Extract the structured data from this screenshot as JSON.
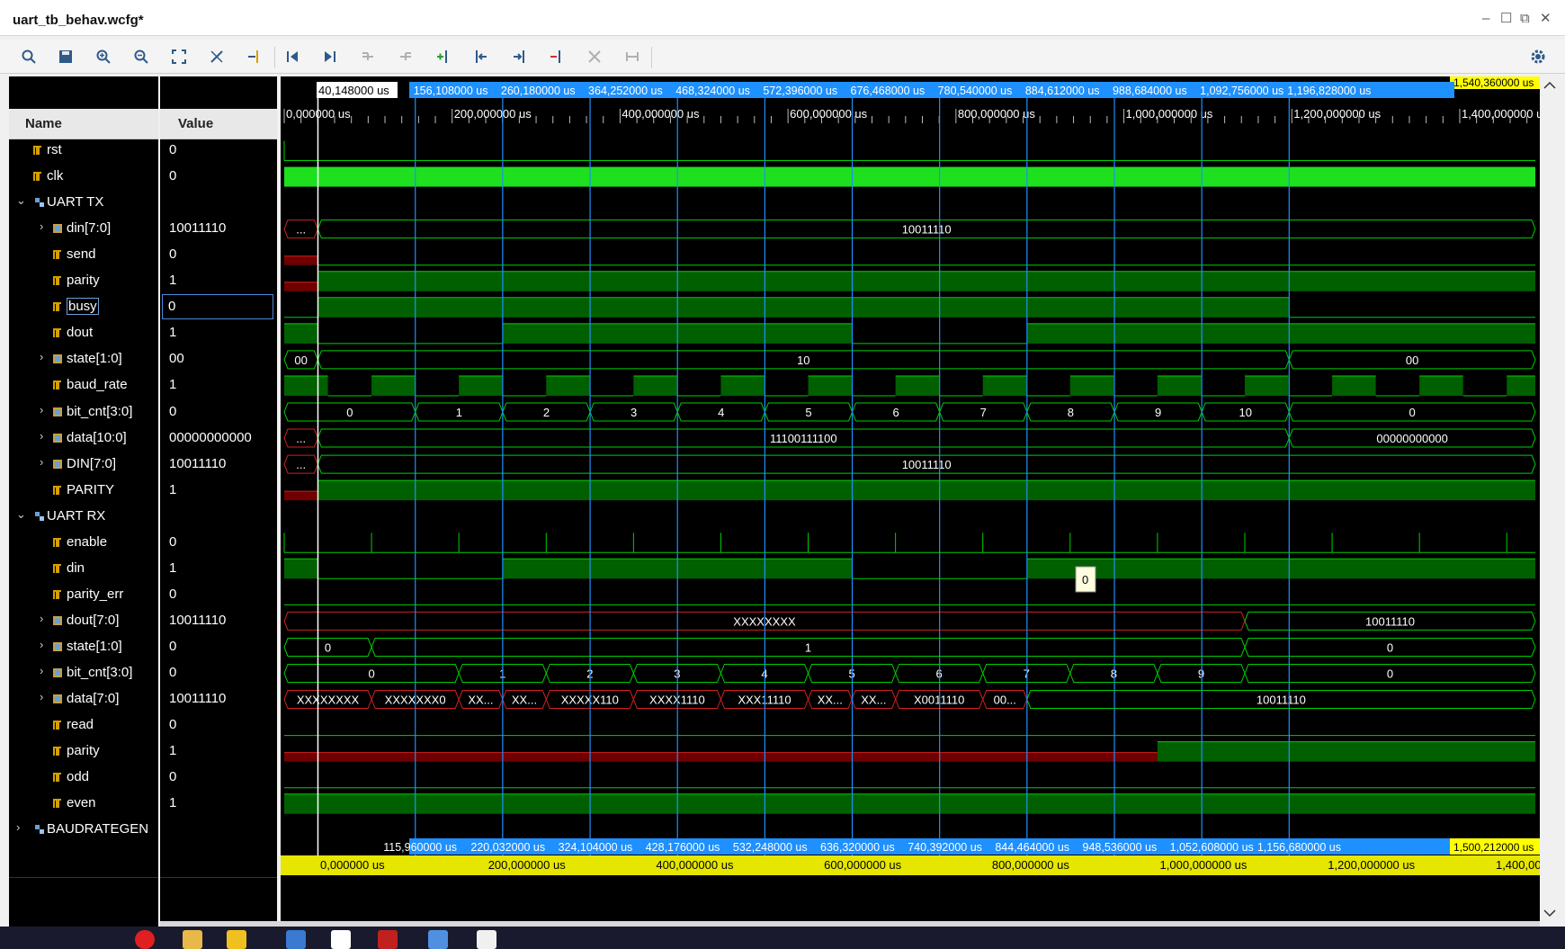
{
  "window": {
    "title": "uart_tb_behav.wcfg*",
    "controls": [
      "–",
      "☐",
      "⧉",
      "✕"
    ]
  },
  "toolbar": {
    "buttons": [
      "search",
      "save",
      "zoom-in",
      "zoom-out",
      "zoom-fit",
      "swap-cursors",
      "go-to-cursor",
      "go-to-time-0",
      "go-to-last-time",
      "previous-transition",
      "next-transition",
      "add-marker",
      "previous-marker",
      "next-marker",
      "remove-marker",
      "delete-all-markers",
      "snap-to-transition",
      "settings"
    ]
  },
  "panels": {
    "name_header": "Name",
    "value_header": "Value"
  },
  "signals": [
    {
      "name": "rst",
      "value": "0",
      "indent": 1,
      "kind": "bit",
      "expand": false
    },
    {
      "name": "clk",
      "value": "0",
      "indent": 1,
      "kind": "bit",
      "expand": false
    },
    {
      "name": "UART TX",
      "value": "",
      "indent": 0,
      "kind": "group",
      "expand": true
    },
    {
      "name": "din[7:0]",
      "value": "10011110",
      "indent": 2,
      "kind": "bus",
      "expand": true
    },
    {
      "name": "send",
      "value": "0",
      "indent": 2,
      "kind": "bit",
      "expand": false
    },
    {
      "name": "parity",
      "value": "1",
      "indent": 2,
      "kind": "bit",
      "expand": false
    },
    {
      "name": "busy",
      "value": "0",
      "indent": 2,
      "kind": "bit",
      "expand": false,
      "selected": true
    },
    {
      "name": "dout",
      "value": "1",
      "indent": 2,
      "kind": "bit",
      "expand": false
    },
    {
      "name": "state[1:0]",
      "value": "00",
      "indent": 2,
      "kind": "bus",
      "expand": true
    },
    {
      "name": "baud_rate",
      "value": "1",
      "indent": 2,
      "kind": "bit",
      "expand": false
    },
    {
      "name": "bit_cnt[3:0]",
      "value": "0",
      "indent": 2,
      "kind": "bus",
      "expand": true
    },
    {
      "name": "data[10:0]",
      "value": "00000000000",
      "indent": 2,
      "kind": "bus",
      "expand": true
    },
    {
      "name": "DIN[7:0]",
      "value": "10011110",
      "indent": 2,
      "kind": "bus",
      "expand": true
    },
    {
      "name": "PARITY",
      "value": "1",
      "indent": 2,
      "kind": "bit",
      "expand": false
    },
    {
      "name": "UART RX",
      "value": "",
      "indent": 0,
      "kind": "group",
      "expand": true
    },
    {
      "name": "enable",
      "value": "0",
      "indent": 2,
      "kind": "bit",
      "expand": false
    },
    {
      "name": "din",
      "value": "1",
      "indent": 2,
      "kind": "bit",
      "expand": false
    },
    {
      "name": "parity_err",
      "value": "0",
      "indent": 2,
      "kind": "bit",
      "expand": false
    },
    {
      "name": "dout[7:0]",
      "value": "10011110",
      "indent": 2,
      "kind": "bus",
      "expand": true
    },
    {
      "name": "state[1:0]",
      "value": "0",
      "indent": 2,
      "kind": "bus",
      "expand": true
    },
    {
      "name": "bit_cnt[3:0]",
      "value": "0",
      "indent": 2,
      "kind": "bus",
      "expand": true
    },
    {
      "name": "data[7:0]",
      "value": "10011110",
      "indent": 2,
      "kind": "bus",
      "expand": true
    },
    {
      "name": "read",
      "value": "0",
      "indent": 2,
      "kind": "bit",
      "expand": false
    },
    {
      "name": "parity",
      "value": "1",
      "indent": 2,
      "kind": "bit",
      "expand": false
    },
    {
      "name": "odd",
      "value": "0",
      "indent": 2,
      "kind": "bit",
      "expand": false
    },
    {
      "name": "even",
      "value": "1",
      "indent": 2,
      "kind": "bit",
      "expand": false
    },
    {
      "name": "BAUDRATEGEN",
      "value": "",
      "indent": 0,
      "kind": "group",
      "expand": true
    }
  ],
  "timeline": {
    "top_marker_cursor": "40,148000 us",
    "top_marker_times": [
      "156,108000 us",
      "260,180000 us",
      "364,252000 us",
      "468,324000 us",
      "572,396000 us",
      "676,468000 us",
      "780,540000 us",
      "884,612000 us",
      "988,684000 us",
      "1,092,756000 us",
      "1,196,828000 us"
    ],
    "top_end_label": "1,540,360000 us",
    "ruler_labels": [
      "0,000000 us",
      "200,000000 us",
      "400,000000 us",
      "600,000000 us",
      "800,000000 us",
      "1,000,000000 us",
      "1,200,000000 us",
      "1,400,000000 us"
    ],
    "bottom_marker_times": [
      "115,960000 us",
      "220,032000 us",
      "324,104000 us",
      "428,176000 us",
      "532,248000 us",
      "636,320000 us",
      "740,392000 us",
      "844,464000 us",
      "948,536000 us",
      "1,052,608000 us",
      "1,156,680000 us"
    ],
    "bottom_end_label": "1,500,212000 us",
    "bottom_ruler_labels": [
      "0,000000 us",
      "200,000000 us",
      "400,000000 us",
      "600,000000 us",
      "800,000000 us",
      "1,000,000000 us",
      "1,200,000000 us",
      "1,400,000000 us"
    ],
    "tooltip": "0",
    "range_us": [
      0,
      1490
    ],
    "cursor_us": 40.148,
    "marker_us": [
      156.108,
      260.18,
      364.252,
      468.324,
      572.396,
      676.468,
      780.54,
      884.612,
      988.684,
      1092.756,
      1196.828
    ]
  },
  "waveforms": {
    "bus_segments": {
      "tx_din": [
        {
          "from": 0,
          "to": 40,
          "label": "...",
          "color": "red"
        },
        {
          "from": 40,
          "to": 1490,
          "label": "10011110",
          "color": "green"
        }
      ],
      "tx_state": [
        {
          "from": 0,
          "to": 40,
          "label": "00",
          "color": "green"
        },
        {
          "from": 40,
          "to": 1196.8,
          "label": "10",
          "color": "green"
        },
        {
          "from": 1196.8,
          "to": 1490,
          "label": "00",
          "color": "green"
        }
      ],
      "tx_bitcnt": [
        {
          "from": 0,
          "to": 156.1,
          "label": "0"
        },
        {
          "from": 156.1,
          "to": 260.2,
          "label": "1"
        },
        {
          "from": 260.2,
          "to": 364.3,
          "label": "2"
        },
        {
          "from": 364.3,
          "to": 468.3,
          "label": "3"
        },
        {
          "from": 468.3,
          "to": 572.4,
          "label": "4"
        },
        {
          "from": 572.4,
          "to": 676.5,
          "label": "5"
        },
        {
          "from": 676.5,
          "to": 780.5,
          "label": "6"
        },
        {
          "from": 780.5,
          "to": 884.6,
          "label": "7"
        },
        {
          "from": 884.6,
          "to": 988.7,
          "label": "8"
        },
        {
          "from": 988.7,
          "to": 1092.8,
          "label": "9"
        },
        {
          "from": 1092.8,
          "to": 1196.8,
          "label": "10"
        },
        {
          "from": 1196.8,
          "to": 1490,
          "label": "0"
        }
      ],
      "tx_data": [
        {
          "from": 0,
          "to": 40,
          "label": "...",
          "color": "red"
        },
        {
          "from": 40,
          "to": 1196.8,
          "label": "11100111100",
          "color": "green"
        },
        {
          "from": 1196.8,
          "to": 1490,
          "label": "00000000000",
          "color": "green"
        }
      ],
      "tx_DIN": [
        {
          "from": 0,
          "to": 40,
          "label": "...",
          "color": "red"
        },
        {
          "from": 40,
          "to": 1490,
          "label": "10011110",
          "color": "green"
        }
      ],
      "rx_dout": [
        {
          "from": 0,
          "to": 1144,
          "label": "XXXXXXXX",
          "color": "red"
        },
        {
          "from": 1144,
          "to": 1490,
          "label": "10011110",
          "color": "green"
        }
      ],
      "rx_state": [
        {
          "from": 0,
          "to": 104,
          "label": "0"
        },
        {
          "from": 104,
          "to": 1144,
          "label": "1"
        },
        {
          "from": 1144,
          "to": 1490,
          "label": "0"
        }
      ],
      "rx_bitcnt": [
        {
          "from": 0,
          "to": 208,
          "label": "0"
        },
        {
          "from": 208,
          "to": 312,
          "label": "1"
        },
        {
          "from": 312,
          "to": 416,
          "label": "2"
        },
        {
          "from": 416,
          "to": 520,
          "label": "3"
        },
        {
          "from": 520,
          "to": 624,
          "label": "4"
        },
        {
          "from": 624,
          "to": 728,
          "label": "5"
        },
        {
          "from": 728,
          "to": 832,
          "label": "6"
        },
        {
          "from": 832,
          "to": 936,
          "label": "7"
        },
        {
          "from": 936,
          "to": 1040,
          "label": "8"
        },
        {
          "from": 1040,
          "to": 1144,
          "label": "9"
        },
        {
          "from": 1144,
          "to": 1490,
          "label": "0"
        }
      ],
      "rx_data": [
        {
          "from": 0,
          "to": 104,
          "label": "XXXXXXXX",
          "color": "red"
        },
        {
          "from": 104,
          "to": 208,
          "label": "XXXXXXX0",
          "color": "red"
        },
        {
          "from": 208,
          "to": 260,
          "label": "XX...",
          "color": "red"
        },
        {
          "from": 260,
          "to": 312,
          "label": "XX...",
          "color": "red"
        },
        {
          "from": 312,
          "to": 416,
          "label": "XXXXX110",
          "color": "red"
        },
        {
          "from": 416,
          "to": 520,
          "label": "XXXX1110",
          "color": "red"
        },
        {
          "from": 520,
          "to": 624,
          "label": "XXX11110",
          "color": "red"
        },
        {
          "from": 624,
          "to": 676,
          "label": "XX...",
          "color": "red"
        },
        {
          "from": 676,
          "to": 728,
          "label": "XX...",
          "color": "red"
        },
        {
          "from": 728,
          "to": 832,
          "label": "X0011110",
          "color": "red"
        },
        {
          "from": 832,
          "to": 884.6,
          "label": "00...",
          "color": "red"
        },
        {
          "from": 884.6,
          "to": 1490,
          "label": "10011110",
          "color": "green"
        }
      ]
    }
  }
}
